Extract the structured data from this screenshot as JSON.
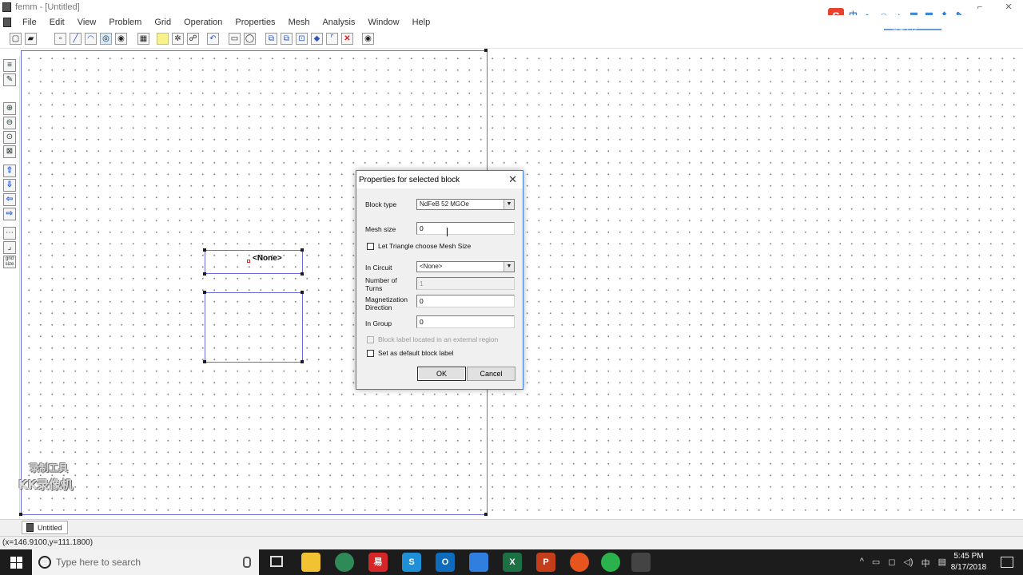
{
  "window": {
    "title": "femm - [Untitled]",
    "controls": [
      "⌐",
      "✕"
    ]
  },
  "menu": [
    "File",
    "Edit",
    "View",
    "Problem",
    "Grid",
    "Operation",
    "Properties",
    "Mesh",
    "Analysis",
    "Window",
    "Help"
  ],
  "ime": {
    "logo": "S",
    "mode": "中",
    "tag": "提案上传"
  },
  "canvas": {
    "block_label": "<None>"
  },
  "watermark": {
    "line1": "录制工具",
    "line2": "KK录像机"
  },
  "document_tab": {
    "label": "Untitled"
  },
  "status": {
    "coords": "(x=146.9100,y=111.1800)"
  },
  "taskbar": {
    "search_placeholder": "Type here to search",
    "apps": [
      "",
      "",
      "易",
      "S",
      "O",
      "",
      "X",
      "P",
      "",
      "",
      ""
    ],
    "tray_icons": [
      "^",
      "▭",
      "◻",
      "◁)",
      "中",
      "▤"
    ],
    "time": "5:45 PM",
    "date": "8/17/2018"
  },
  "dialog": {
    "title": "Properties for selected block",
    "close": "✕",
    "block_type_label": "Block type",
    "block_type_value": "NdFeB 52 MGOe",
    "mesh_size_label": "Mesh size",
    "mesh_size_value": "0",
    "let_triangle_label": "Let Triangle choose Mesh Size",
    "let_triangle_checked": false,
    "in_circuit_label": "In Circuit",
    "in_circuit_value": "<None>",
    "num_turns_label1": "Number of",
    "num_turns_label2": "Turns",
    "num_turns_value": "1",
    "mag_dir_label1": "Magnetization",
    "mag_dir_label2": "Direction",
    "mag_dir_value": "0",
    "in_group_label": "In Group",
    "in_group_value": "0",
    "external_region_label": "Block label located in an external region",
    "default_label_label": "Set as default block label",
    "ok": "OK",
    "cancel": "Cancel",
    "combo_arrow": "▼"
  },
  "colors": {
    "boundary": "#6a6ad8",
    "dialog_border": "#3c78d8",
    "taskbar": "#1c1c1c"
  }
}
